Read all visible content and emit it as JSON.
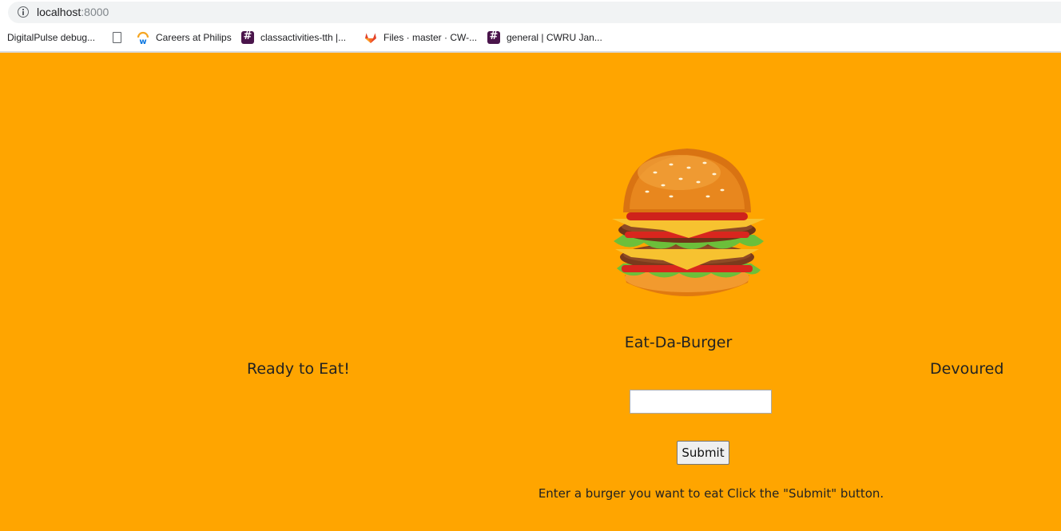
{
  "browser": {
    "url_host": "localhost",
    "url_port": ":8000",
    "bookmarks": [
      {
        "label": "DigitalPulse debug...",
        "icon": "none"
      },
      {
        "label": "",
        "icon": "document-icon"
      },
      {
        "label": "Careers at Philips",
        "icon": "workday-icon"
      },
      {
        "label": "classactivities-tth |...",
        "icon": "slack-icon"
      },
      {
        "label": "Files · master · CW-...",
        "icon": "gitlab-icon"
      },
      {
        "label": "general | CWRU Jan...",
        "icon": "slack-icon"
      }
    ]
  },
  "page": {
    "background_color": "#ffa500",
    "app_title": "Eat-Da-Burger",
    "ready_heading": "Ready to Eat!",
    "devoured_heading": "Devoured",
    "input": {
      "value": "",
      "placeholder": ""
    },
    "submit_label": "Submit",
    "instructions": "Enter a burger you want to eat Click the \"Submit\" button."
  }
}
